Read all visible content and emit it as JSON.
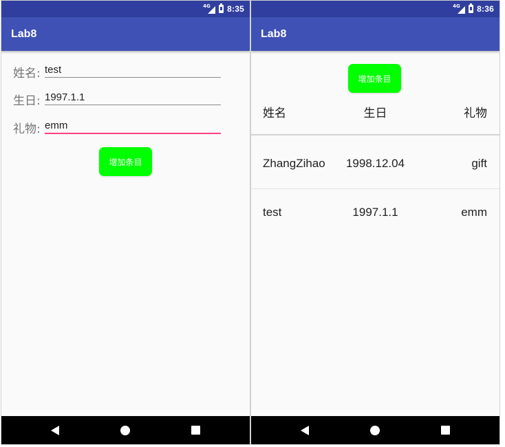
{
  "screens": [
    {
      "status": {
        "network": "4G",
        "time": "8:35"
      },
      "app_title": "Lab8",
      "form": {
        "name_label": "姓名:",
        "name_value": "test",
        "birthday_label": "生日:",
        "birthday_value": "1997.1.1",
        "gift_label": "礼物:",
        "gift_value": "emm",
        "add_button_label": "增加条目"
      },
      "nav": {
        "back_icon": "back-triangle-icon",
        "home_icon": "home-circle-icon",
        "recents_icon": "recents-square-icon"
      }
    },
    {
      "status": {
        "network": "4G",
        "time": "8:36"
      },
      "app_title": "Lab8",
      "add_button_label": "增加条目",
      "table": {
        "headers": [
          "姓名",
          "生日",
          "礼物"
        ],
        "rows": [
          [
            "ZhangZihao",
            "1998.12.04",
            "gift"
          ],
          [
            "test",
            "1997.1.1",
            "emm"
          ]
        ]
      },
      "nav": {
        "back_icon": "back-triangle-icon",
        "home_icon": "home-circle-icon",
        "recents_icon": "recents-square-icon"
      }
    }
  ],
  "colors": {
    "status_bar": "#303f9f",
    "app_bar": "#3f51b5",
    "button": "#00ff00",
    "input_focus": "#ff4081",
    "background": "#fafafa"
  }
}
